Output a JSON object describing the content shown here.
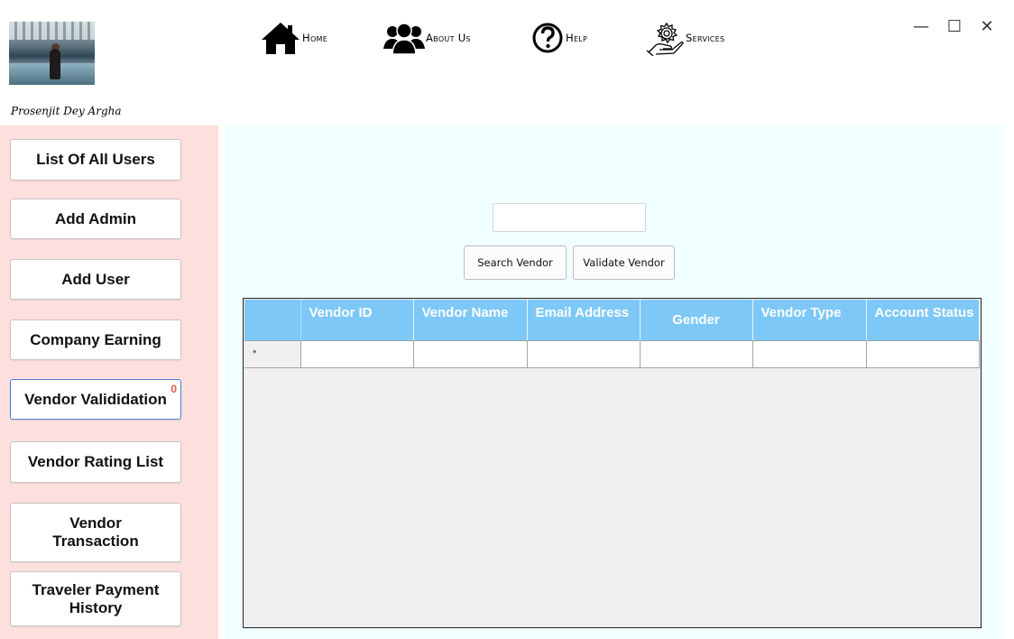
{
  "profile": {
    "name": "Prosenjit Dey Argha"
  },
  "nav": [
    {
      "label": "Home",
      "icon": "home-icon"
    },
    {
      "label": "About Us",
      "icon": "users-icon"
    },
    {
      "label": "Help",
      "icon": "help-icon"
    },
    {
      "label": "Services",
      "icon": "services-gear-hand-icon"
    }
  ],
  "window": {
    "minimize": "—",
    "maximize": "☐",
    "close": "✕"
  },
  "sidebar": {
    "buttons": [
      {
        "label": "List Of All Users"
      },
      {
        "label": "Add Admin"
      },
      {
        "label": "Add User"
      },
      {
        "label": "Company Earning"
      },
      {
        "label": "Vendor Valididation",
        "badge": "0",
        "active": true
      },
      {
        "label": "Vendor Rating List"
      },
      {
        "label": "Vendor Transaction"
      },
      {
        "label": "Traveler Payment History"
      }
    ]
  },
  "main": {
    "search_value": "",
    "search_button": "Search Vendor",
    "validate_button": "Validate Vendor",
    "grid": {
      "columns": [
        "Vendor ID",
        "Vendor Name",
        "Email Address",
        "Gender",
        "Vendor Type",
        "Account Status"
      ],
      "new_row_marker": "*"
    }
  },
  "colors": {
    "sidebar_bg": "#fde0de",
    "main_bg": "#f0ffff",
    "grid_header": "#7ec8f7",
    "badge": "#e05a57",
    "active_border": "#4a7fd6"
  }
}
